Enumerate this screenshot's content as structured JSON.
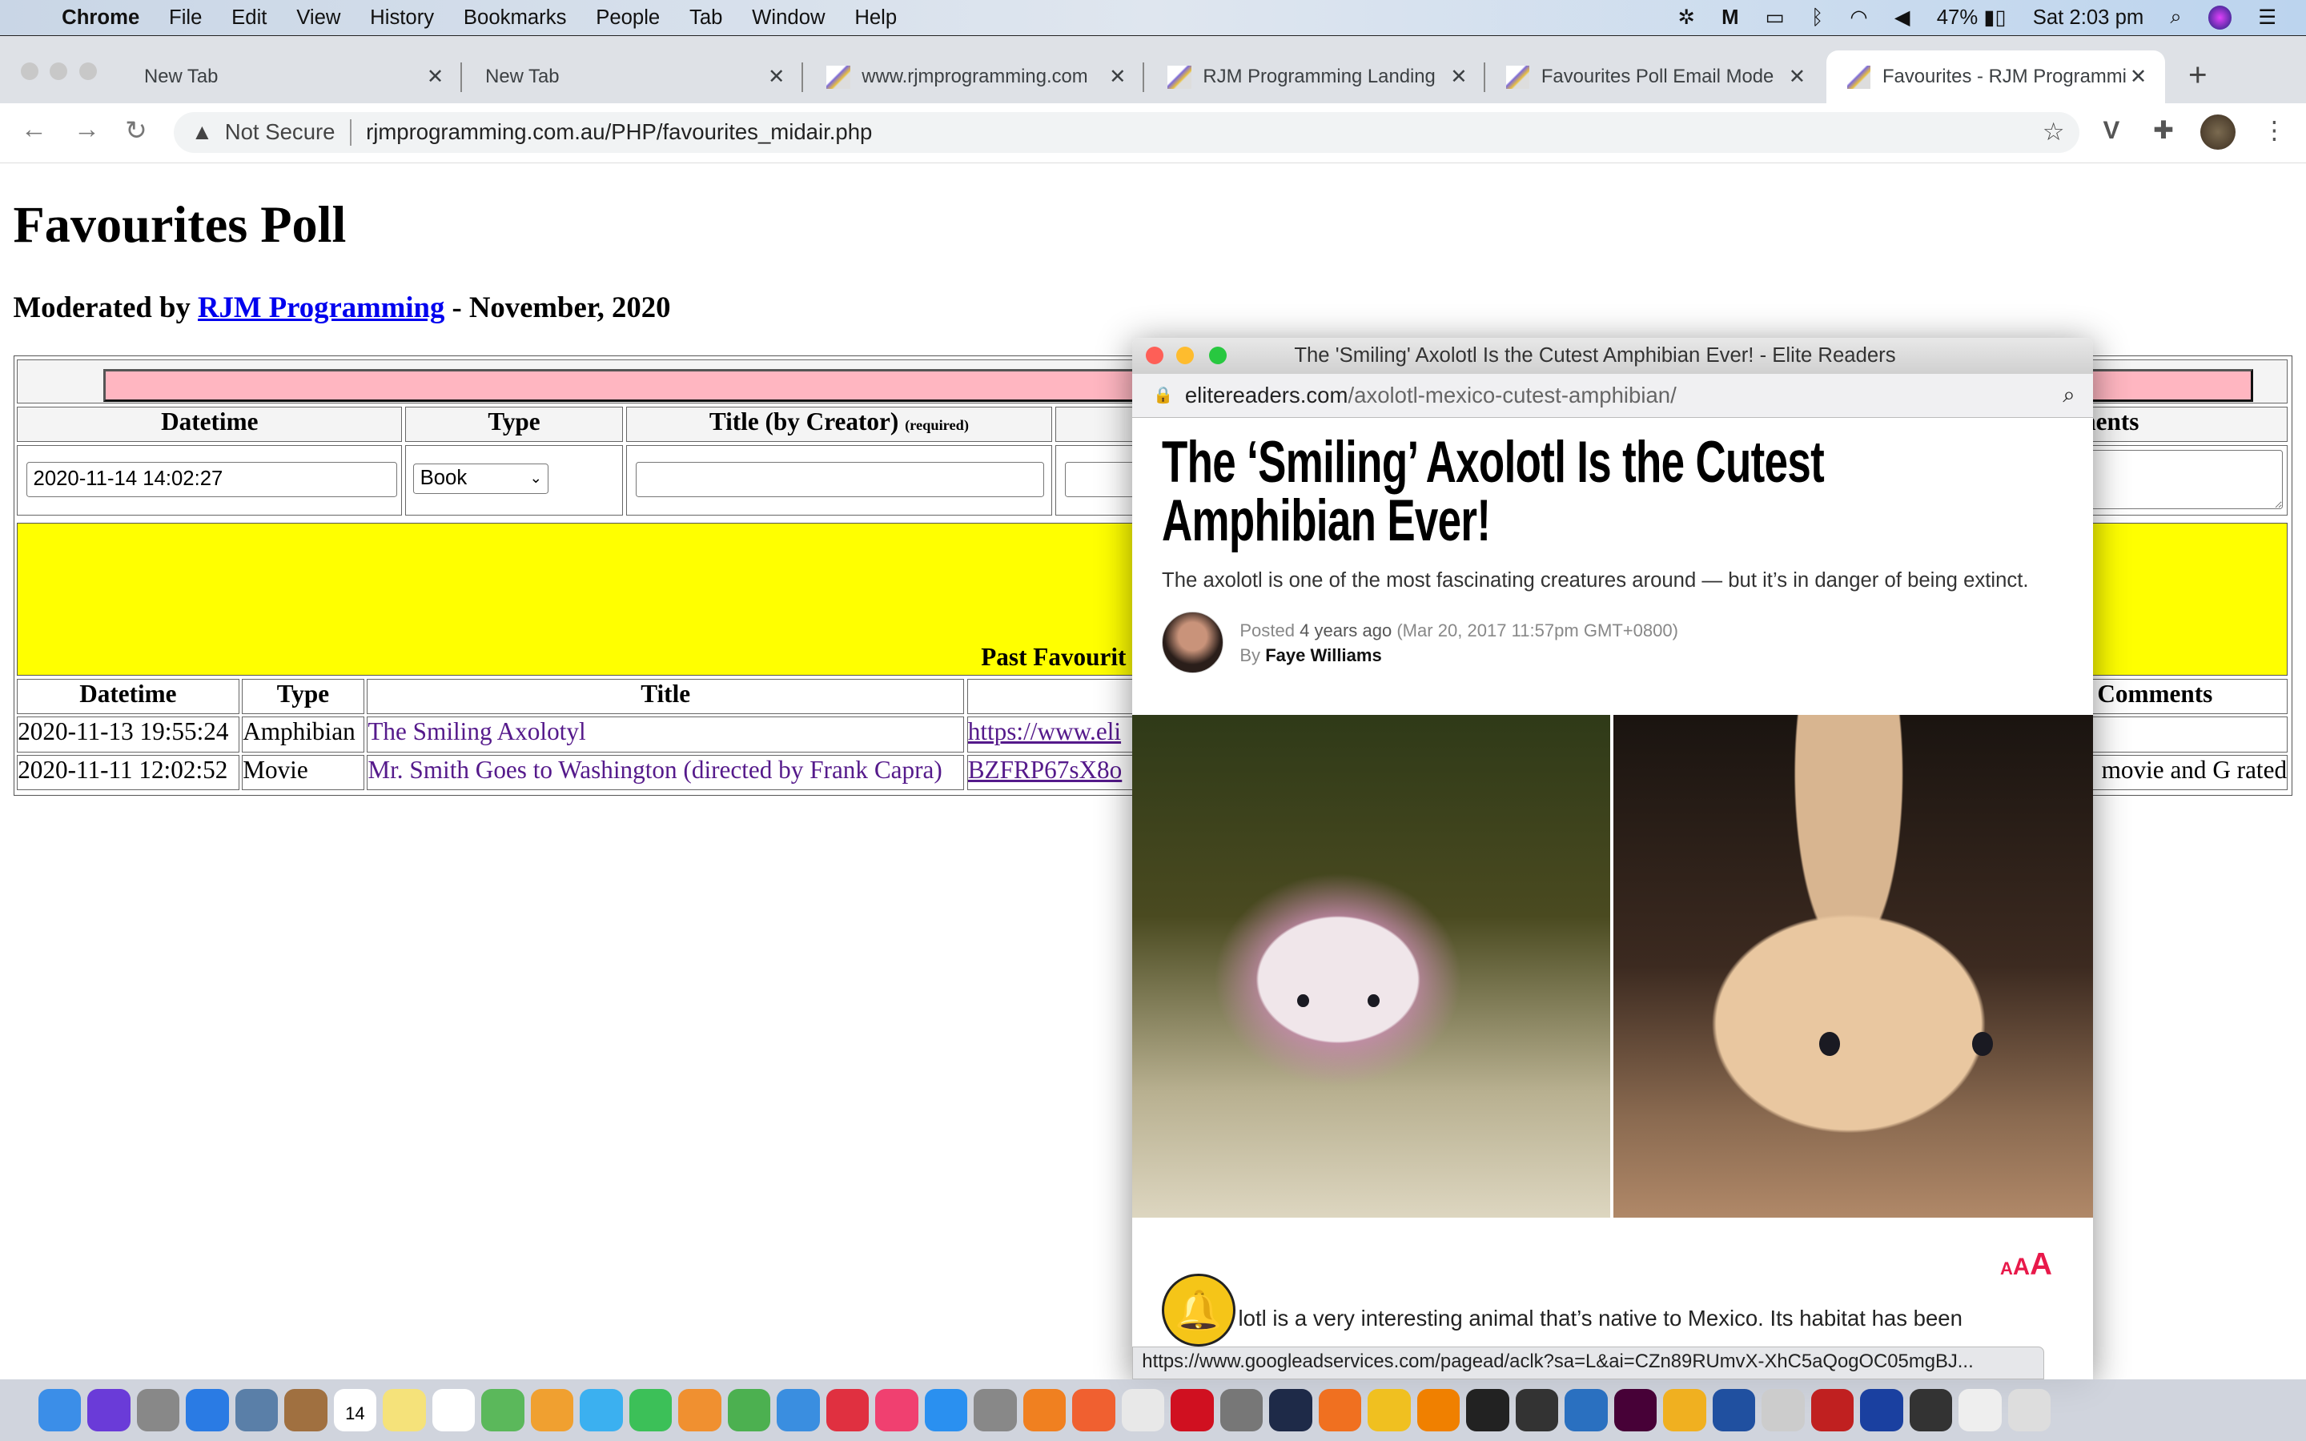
{
  "menubar": {
    "app": "Chrome",
    "items": [
      "File",
      "Edit",
      "View",
      "History",
      "Bookmarks",
      "People",
      "Tab",
      "Window",
      "Help"
    ],
    "battery": "47%",
    "clock": "Sat 2:03 pm"
  },
  "tabs": [
    {
      "title": "New Tab",
      "active": false
    },
    {
      "title": "New Tab",
      "active": false
    },
    {
      "title": "www.rjmprogramming.com",
      "active": false
    },
    {
      "title": "RJM Programming Landing",
      "active": false
    },
    {
      "title": "Favourites Poll Email Mode",
      "active": false
    },
    {
      "title": "Favourites - RJM Programming",
      "active": true
    }
  ],
  "toolbar": {
    "security": "Not Secure",
    "url": "rjmprogramming.com.au/PHP/favourites_midair.php"
  },
  "page": {
    "title": "Favourites Poll",
    "moderated_prefix": "Moderated by ",
    "moderator_link": "RJM Programming",
    "moderated_suffix": " - November, 2020",
    "form": {
      "headers": {
        "datetime": "Datetime",
        "type": "Type",
        "title": "Title (by Creator)",
        "required": "(required)",
        "comments": "Comments"
      },
      "datetime_value": "2020-11-14 14:02:27",
      "type_value": "Book",
      "title_value": ""
    },
    "past_caption": "Past Favourit",
    "past": {
      "headers": {
        "datetime": "Datetime",
        "type": "Type",
        "title": "Title",
        "comments": "Comments"
      },
      "rows": [
        {
          "datetime": "2020-11-13 19:55:24",
          "type": "Amphibian",
          "title": "The Smiling Axolotyl",
          "link": "https://www.eli",
          "comments": ""
        },
        {
          "datetime": "2020-11-11 12:02:52",
          "type": "Movie",
          "title": "Mr. Smith Goes to Washington (directed by Frank Capra)",
          "link": "BZFRP67sX8o",
          "comments": "movie and G rated"
        }
      ]
    }
  },
  "popup": {
    "window_title": "The 'Smiling' Axolotl Is the Cutest Amphibian Ever! - Elite Readers",
    "url_domain": "elitereaders.com",
    "url_path": "/axolotl-mexico-cutest-amphibian/",
    "headline_1": "The ‘Smiling’ Axolotl Is the Cutest",
    "headline_2": "Amphibian Ever!",
    "subtitle": "The axolotl is one of the most fascinating creatures around — but it’s in danger of being extinct.",
    "posted_label": "Posted",
    "posted_ago": "4 years ago",
    "posted_date": "(Mar 20, 2017 11:57pm GMT+0800)",
    "by_label": "By",
    "author": "Faye Williams",
    "font_size_control": "AAA",
    "body_text": "lotl is a very interesting animal that’s native to Mexico. Its habitat has been",
    "status_url": "https://www.googleadservices.com/pagead/aclk?sa=L&ai=CZn89RUmvX-XhC5aQogOC05mgBJ...",
    "accent_color": "#e8194a"
  },
  "dock": {
    "calendar_day": "14",
    "icons": [
      "finder",
      "siri",
      "launchpad",
      "safari",
      "preview",
      "notes-book",
      "calendar",
      "notes",
      "reminders",
      "maps",
      "photos",
      "messages",
      "facetime",
      "pages",
      "numbers",
      "keynote",
      "news",
      "music",
      "app-store",
      "system-preferences",
      "aws",
      "firefox",
      "chrome",
      "opera",
      "gimp",
      "photoshop",
      "sublime",
      "coda",
      "vlc",
      "terminal",
      "inkscape",
      "r",
      "xd",
      "kodak",
      "flow",
      "scanner",
      "filezilla",
      "audacity",
      "font",
      "textedit",
      "trash"
    ]
  }
}
